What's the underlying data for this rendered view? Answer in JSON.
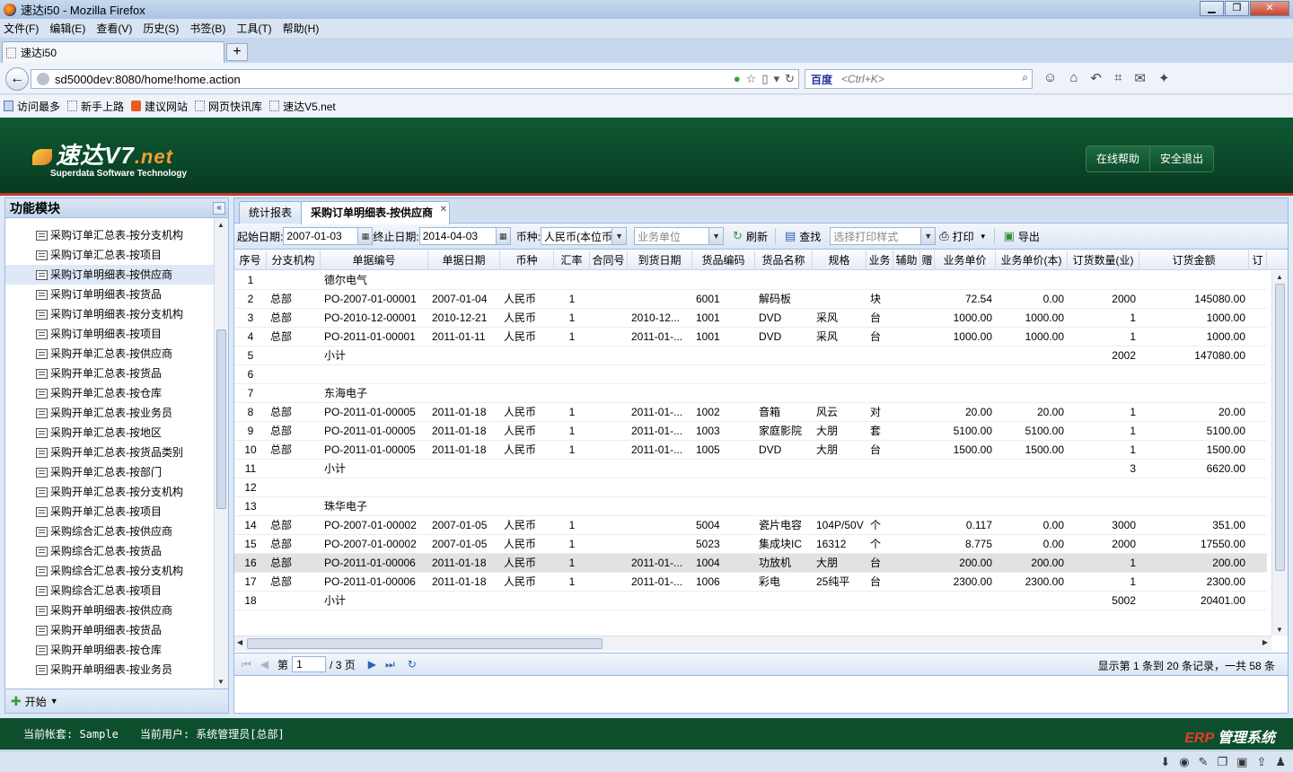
{
  "browser": {
    "window_title": "速达i50 - Mozilla Firefox",
    "menu": [
      "文件(F)",
      "编辑(E)",
      "查看(V)",
      "历史(S)",
      "书签(B)",
      "工具(T)",
      "帮助(H)"
    ],
    "tab_title": "速达i50",
    "new_tab": "+",
    "url": "sd5000dev:8080/home!home.action",
    "search_engine": "百度",
    "search_placeholder": "<Ctrl+K>",
    "bookmarks": [
      "访问最多",
      "新手上路",
      "建议网站",
      "网页快讯库",
      "速达V5.net"
    ]
  },
  "header": {
    "logo_text": "速达V7",
    "logo_suffix": ".net",
    "logo_subtitle": "Superdata  Software Technology",
    "help_button": "在线帮助",
    "logout_button": "安全退出"
  },
  "left_panel": {
    "title": "功能模块",
    "collapse_icon": "«",
    "items": [
      "采购订单汇总表-按分支机构",
      "采购订单汇总表-按项目",
      "采购订单明细表-按供应商",
      "采购订单明细表-按货品",
      "采购订单明细表-按分支机构",
      "采购订单明细表-按项目",
      "采购开单汇总表-按供应商",
      "采购开单汇总表-按货品",
      "采购开单汇总表-按仓库",
      "采购开单汇总表-按业务员",
      "采购开单汇总表-按地区",
      "采购开单汇总表-按货品类别",
      "采购开单汇总表-按部门",
      "采购开单汇总表-按分支机构",
      "采购开单汇总表-按项目",
      "采购综合汇总表-按供应商",
      "采购综合汇总表-按货品",
      "采购综合汇总表-按分支机构",
      "采购综合汇总表-按项目",
      "采购开单明细表-按供应商",
      "采购开单明细表-按货品",
      "采购开单明细表-按仓库",
      "采购开单明细表-按业务员"
    ],
    "selected_index": 2,
    "start_label": "开始"
  },
  "main": {
    "tabs": [
      {
        "label": "统计报表"
      },
      {
        "label": "采购订单明细表-按供应商"
      }
    ],
    "toolbar": {
      "start_date_label": "起始日期:",
      "start_date": "2007-01-03",
      "end_date_label": "终止日期:",
      "end_date": "2014-04-03",
      "currency_label": "币种:",
      "currency": "人民币(本位币",
      "business_unit_placeholder": "业务单位",
      "refresh": "刷新",
      "find": "查找",
      "print_style_placeholder": "选择打印样式",
      "print": "打印",
      "export": "导出"
    },
    "columns": [
      "序号",
      "分支机构",
      "单据编号",
      "单据日期",
      "币种",
      "汇率",
      "合同号",
      "到货日期",
      "货品编码",
      "货品名称",
      "规格",
      "业务",
      "辅助",
      "赠",
      "业务单价",
      "业务单价(本)",
      "订货数量(业)",
      "订货金额",
      "订"
    ],
    "rows": [
      [
        "1",
        "",
        "德尔电气",
        "",
        "",
        "",
        "",
        "",
        "",
        "",
        "",
        "",
        "",
        "",
        "",
        "",
        "",
        ""
      ],
      [
        "2",
        "总部",
        "PO-2007-01-00001",
        "2007-01-04",
        "人民币",
        "1",
        "",
        "",
        "6001",
        "解码板",
        "",
        "块",
        "",
        "",
        "72.54",
        "0.00",
        "2000",
        "145080.00"
      ],
      [
        "3",
        "总部",
        "PO-2010-12-00001",
        "2010-12-21",
        "人民币",
        "1",
        "",
        "2010-12...",
        "1001",
        "DVD",
        "采风",
        "台",
        "",
        "",
        "1000.00",
        "1000.00",
        "1",
        "1000.00"
      ],
      [
        "4",
        "总部",
        "PO-2011-01-00001",
        "2011-01-11",
        "人民币",
        "1",
        "",
        "2011-01-...",
        "1001",
        "DVD",
        "采风",
        "台",
        "",
        "",
        "1000.00",
        "1000.00",
        "1",
        "1000.00"
      ],
      [
        "5",
        "",
        "小计",
        "",
        "",
        "",
        "",
        "",
        "",
        "",
        "",
        "",
        "",
        "",
        "",
        "",
        "2002",
        "147080.00"
      ],
      [
        "6",
        "",
        "",
        "",
        "",
        "",
        "",
        "",
        "",
        "",
        "",
        "",
        "",
        "",
        "",
        "",
        "",
        ""
      ],
      [
        "7",
        "",
        "东海电子",
        "",
        "",
        "",
        "",
        "",
        "",
        "",
        "",
        "",
        "",
        "",
        "",
        "",
        "",
        ""
      ],
      [
        "8",
        "总部",
        "PO-2011-01-00005",
        "2011-01-18",
        "人民币",
        "1",
        "",
        "2011-01-...",
        "1002",
        "音箱",
        "风云",
        "对",
        "",
        "",
        "20.00",
        "20.00",
        "1",
        "20.00"
      ],
      [
        "9",
        "总部",
        "PO-2011-01-00005",
        "2011-01-18",
        "人民币",
        "1",
        "",
        "2011-01-...",
        "1003",
        "家庭影院",
        "大朋",
        "套",
        "",
        "",
        "5100.00",
        "5100.00",
        "1",
        "5100.00"
      ],
      [
        "10",
        "总部",
        "PO-2011-01-00005",
        "2011-01-18",
        "人民币",
        "1",
        "",
        "2011-01-...",
        "1005",
        "DVD",
        "大朋",
        "台",
        "",
        "",
        "1500.00",
        "1500.00",
        "1",
        "1500.00"
      ],
      [
        "11",
        "",
        "小计",
        "",
        "",
        "",
        "",
        "",
        "",
        "",
        "",
        "",
        "",
        "",
        "",
        "",
        "3",
        "6620.00"
      ],
      [
        "12",
        "",
        "",
        "",
        "",
        "",
        "",
        "",
        "",
        "",
        "",
        "",
        "",
        "",
        "",
        "",
        "",
        ""
      ],
      [
        "13",
        "",
        "珠华电子",
        "",
        "",
        "",
        "",
        "",
        "",
        "",
        "",
        "",
        "",
        "",
        "",
        "",
        "",
        ""
      ],
      [
        "14",
        "总部",
        "PO-2007-01-00002",
        "2007-01-05",
        "人民币",
        "1",
        "",
        "",
        "5004",
        "瓷片电容",
        "104P/50V",
        "个",
        "",
        "",
        "0.117",
        "0.00",
        "3000",
        "351.00"
      ],
      [
        "15",
        "总部",
        "PO-2007-01-00002",
        "2007-01-05",
        "人民币",
        "1",
        "",
        "",
        "5023",
        "集成块IC",
        "16312",
        "个",
        "",
        "",
        "8.775",
        "0.00",
        "2000",
        "17550.00"
      ],
      [
        "16",
        "总部",
        "PO-2011-01-00006",
        "2011-01-18",
        "人民币",
        "1",
        "",
        "2011-01-...",
        "1004",
        "功放机",
        "大朋",
        "台",
        "",
        "",
        "200.00",
        "200.00",
        "1",
        "200.00"
      ],
      [
        "17",
        "总部",
        "PO-2011-01-00006",
        "2011-01-18",
        "人民币",
        "1",
        "",
        "2011-01-...",
        "1006",
        "彩电",
        "25纯平",
        "台",
        "",
        "",
        "2300.00",
        "2300.00",
        "1",
        "2300.00"
      ],
      [
        "18",
        "",
        "小计",
        "",
        "",
        "",
        "",
        "",
        "",
        "",
        "",
        "",
        "",
        "",
        "",
        "",
        "5002",
        "20401.00"
      ]
    ],
    "highlight_row_index": 15,
    "pager": {
      "page_prefix": "第",
      "page_value": "1",
      "page_suffix": "/ 3 页",
      "info": "显示第 1 条到 20 条记录，一共 58 条"
    }
  },
  "footer": {
    "account": "当前帐套: Sample",
    "user": "当前用户: 系统管理员[总部]",
    "erp": "ERP",
    "system": " 管理系统"
  },
  "colors": {
    "header_green": "#0a4427",
    "accent_red": "#c0392b",
    "panel_border": "#99bbe8"
  }
}
